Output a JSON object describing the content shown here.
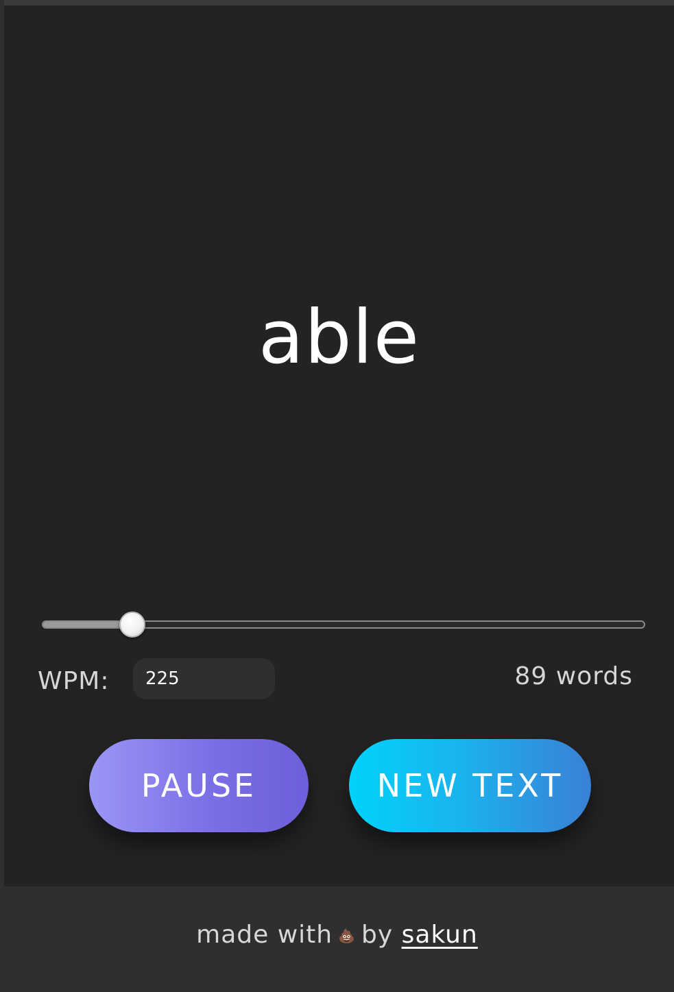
{
  "reader": {
    "current_word": "able"
  },
  "speed_slider": {
    "value": 225,
    "min": 0,
    "max": 1500
  },
  "wpm": {
    "label": "WPM:",
    "value": "225"
  },
  "word_count": {
    "text": "89 words"
  },
  "buttons": {
    "pause_label": "PAUSE",
    "new_text_label": "NEW TEXT"
  },
  "footer": {
    "made_with": "made with",
    "icon": "poop-emoji-icon",
    "icon_glyph": "💩",
    "by": "by",
    "author_link": "sakun"
  },
  "colors": {
    "background": "#232323",
    "footer_background": "#2f2e31",
    "pause_gradient_start": "#9a96f5",
    "pause_gradient_end": "#6c5fd9",
    "new_text_gradient_start": "#00d2fb",
    "new_text_gradient_end": "#3a80d6"
  }
}
